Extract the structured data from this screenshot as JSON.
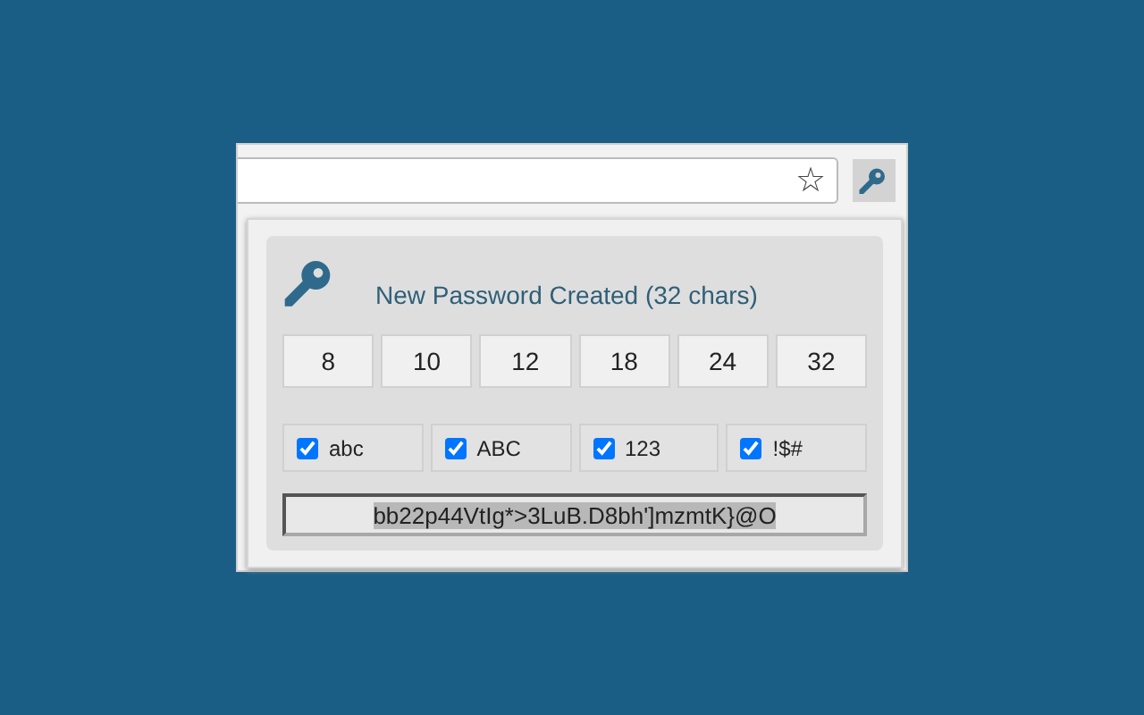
{
  "toolbar": {
    "bookmark_icon": "☆",
    "extension_active": true
  },
  "popup": {
    "title": "New Password Created (32 chars)",
    "lengths": [
      {
        "label": "8",
        "selected": false
      },
      {
        "label": "10",
        "selected": false
      },
      {
        "label": "12",
        "selected": false
      },
      {
        "label": "18",
        "selected": false
      },
      {
        "label": "24",
        "selected": false
      },
      {
        "label": "32",
        "selected": false
      }
    ],
    "options": [
      {
        "label": "abc",
        "checked": true
      },
      {
        "label": "ABC",
        "checked": true
      },
      {
        "label": "123",
        "checked": true
      },
      {
        "label": "!$#",
        "checked": true
      }
    ],
    "password": {
      "value": "bb22p44VtIg*>3LuB.D8bh']mzmtK}@O",
      "highlighted": true
    }
  }
}
